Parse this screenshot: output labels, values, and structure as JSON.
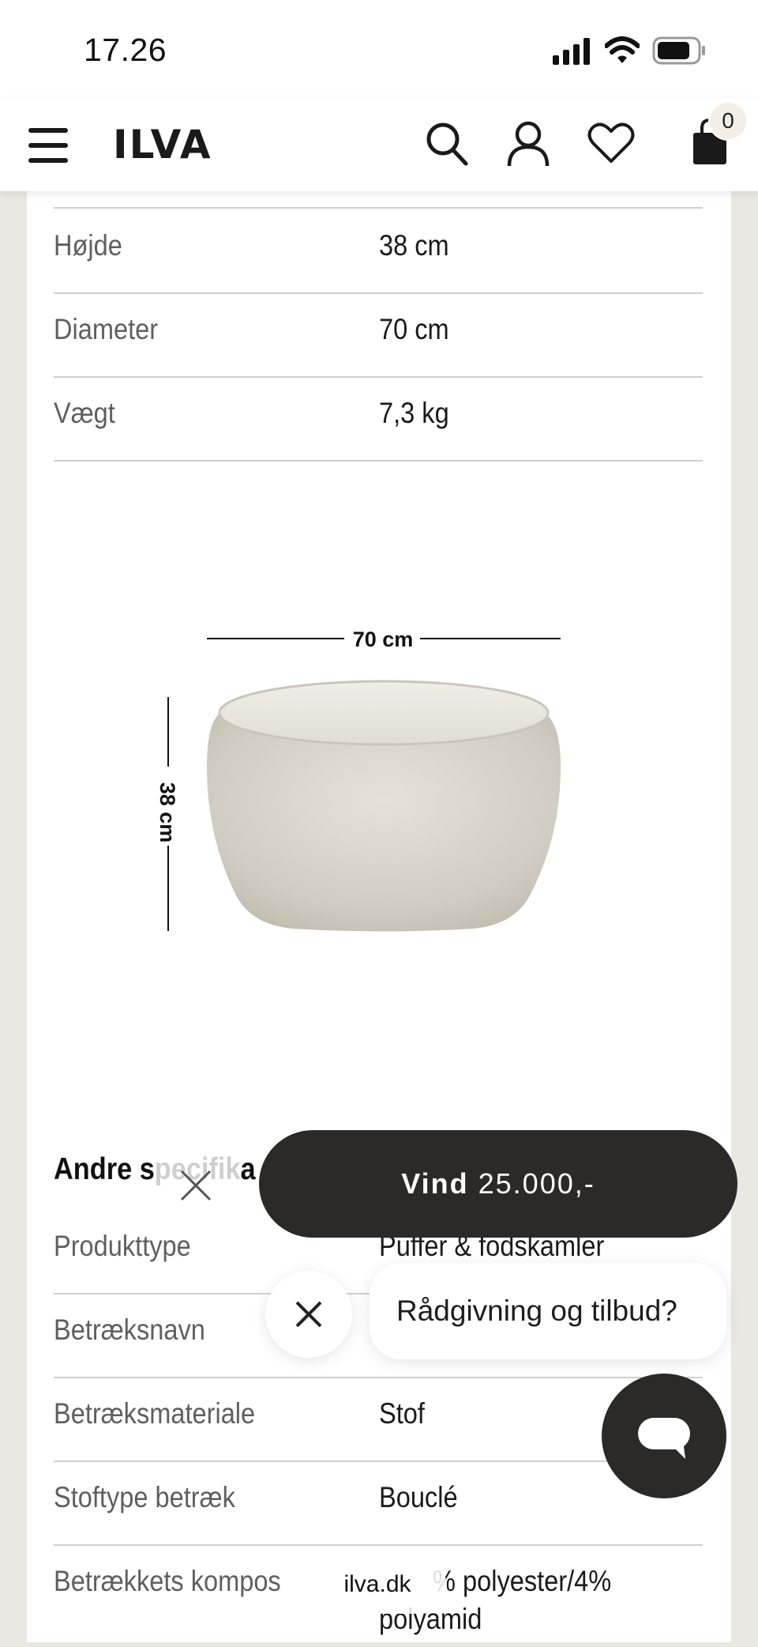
{
  "status_bar": {
    "time": "17.26"
  },
  "header": {
    "logo": "ILVA",
    "cart_count": "0",
    "icons": [
      "menu-icon",
      "search-icon",
      "account-icon",
      "heart-icon",
      "bag-icon"
    ]
  },
  "dimensions_table": [
    {
      "label": "Højde",
      "value": "38 cm"
    },
    {
      "label": "Diameter",
      "value": "70 cm"
    },
    {
      "label": "Vægt",
      "value": "7,3 kg"
    }
  ],
  "product_image": {
    "width_label": "70 cm",
    "height_label": "38 cm"
  },
  "specs": {
    "title_visible": "Andre s",
    "title_faded": "pecifik",
    "title_end": "a",
    "rows": [
      {
        "label": "Produkttype",
        "value": "Puffer & fodskamler"
      },
      {
        "label": "Betræksnavn",
        "value": ""
      },
      {
        "label": "Betræksmateriale",
        "value": "Stof"
      },
      {
        "label": "Stoftype betræk",
        "value": "Bouclé"
      },
      {
        "label": "Betrækkets kompos",
        "value": "% polyester/4%",
        "value2": "polyamid"
      }
    ]
  },
  "promo": {
    "bold": "Vind",
    "amount": "25.000,-"
  },
  "chat": {
    "prompt": "Rådgivning og tilbud?"
  },
  "browser": {
    "url": "ilva.dk"
  },
  "colors": {
    "dark": "#2b2a29",
    "page_bg": "#ebe7e1",
    "card_bg": "#ffffff"
  }
}
